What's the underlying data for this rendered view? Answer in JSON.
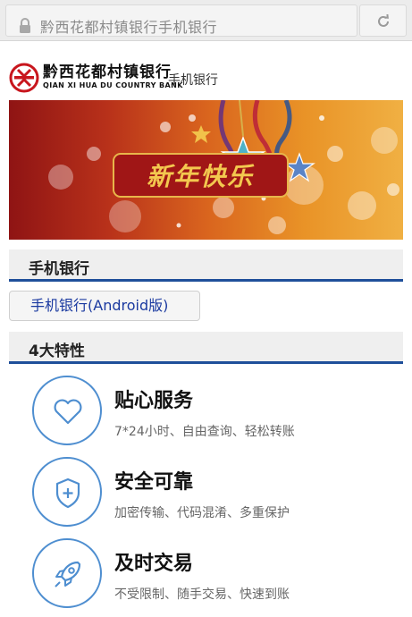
{
  "browser": {
    "url_text": "黔西花都村镇银行手机银行",
    "lock_icon": "lock-icon",
    "reload_icon": "reload-icon"
  },
  "header": {
    "bank_name_cn": "黔西花都村镇银行",
    "bank_name_en": "QIAN XI HUA DU COUNTRY BANK",
    "subtitle": "手机银行"
  },
  "banner": {
    "greeting": "新年快乐"
  },
  "mobile_section": {
    "title": "手机银行",
    "download_button": "手机银行(Android版)"
  },
  "features_section": {
    "title": "4大特性",
    "items": [
      {
        "title": "贴心服务",
        "desc": "7*24小时、自由查询、轻松转账",
        "icon": "heart-icon"
      },
      {
        "title": "安全可靠",
        "desc": "加密传输、代码混淆、多重保护",
        "icon": "shield-icon"
      },
      {
        "title": "及时交易",
        "desc": "不受限制、随手交易、快速到账",
        "icon": "rocket-icon"
      }
    ]
  },
  "colors": {
    "accent_blue": "#1f4f9a",
    "icon_blue": "#4e8ed0",
    "link_blue": "#1b3aa0",
    "logo_red": "#c8161d"
  }
}
